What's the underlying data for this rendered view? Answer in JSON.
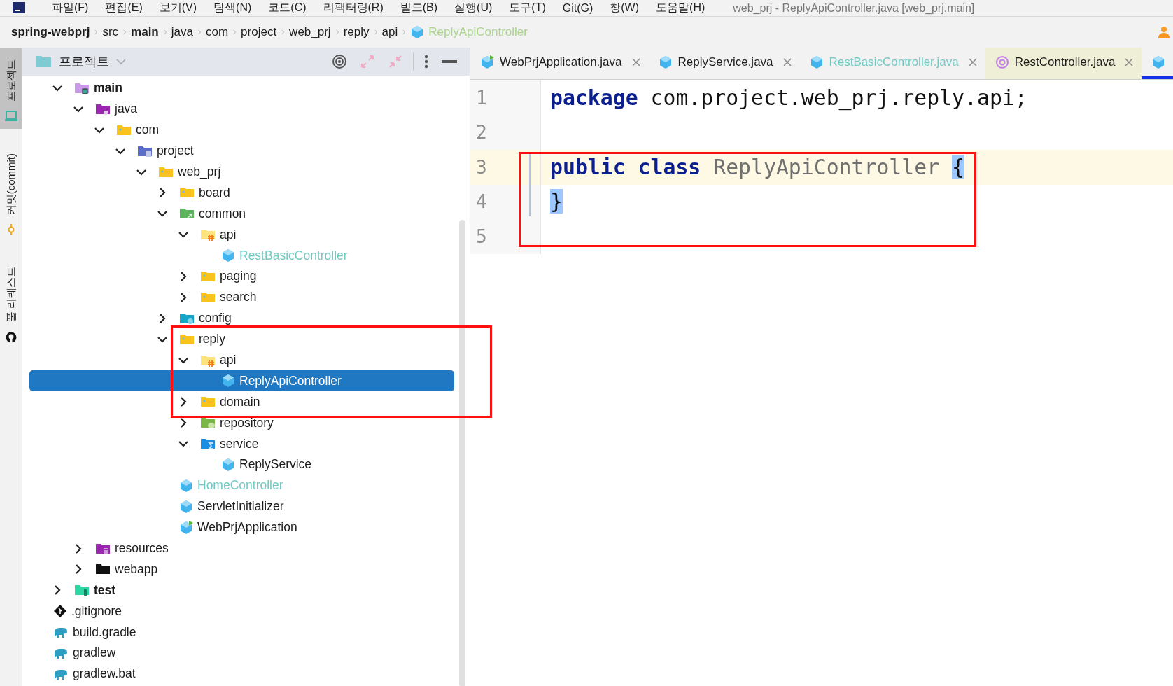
{
  "menu_bar": {
    "items": [
      "파일(F)",
      "편집(E)",
      "보기(V)",
      "탐색(N)",
      "코드(C)",
      "리팩터링(R)",
      "빌드(B)",
      "실행(U)",
      "도구(T)",
      "Git(G)",
      "창(W)",
      "도움말(H)"
    ],
    "title": "web_prj - ReplyApiController.java [web_prj.main]"
  },
  "breadcrumb": [
    {
      "label": "spring-webprj",
      "bold": true,
      "color": "#1b1b1b"
    },
    {
      "label": "src",
      "bold": false,
      "color": "#1b1b1b"
    },
    {
      "label": "main",
      "bold": true,
      "color": "#1b1b1b"
    },
    {
      "label": "java",
      "bold": false,
      "color": "#1b1b1b"
    },
    {
      "label": "com",
      "bold": false,
      "color": "#1b1b1b"
    },
    {
      "label": "project",
      "bold": false,
      "color": "#1b1b1b"
    },
    {
      "label": "web_prj",
      "bold": false,
      "color": "#1b1b1b"
    },
    {
      "label": "reply",
      "bold": false,
      "color": "#1b1b1b"
    },
    {
      "label": "api",
      "bold": false,
      "color": "#1b1b1b"
    },
    {
      "label": "ReplyApiController",
      "bold": false,
      "color": "#a9d48a",
      "kind": "class"
    }
  ],
  "tool_strip": [
    {
      "label": "프로젝트",
      "kind": "monitor",
      "selected": true
    },
    {
      "label": "커밋(commit)",
      "kind": "commit",
      "selected": false
    },
    {
      "label": "풀 리퀘스트",
      "kind": "github",
      "selected": false
    }
  ],
  "project_panel": {
    "title": "프로젝트",
    "toolbar": [
      {
        "kind": "target",
        "disabled": false
      },
      {
        "kind": "expand",
        "disabled": true
      },
      {
        "kind": "collapse",
        "disabled": true
      },
      {
        "kind": "more",
        "disabled": false
      },
      {
        "kind": "minimize",
        "disabled": false
      }
    ],
    "tree": [
      {
        "kind": "scrolled-off-parent",
        "children": [
          {
            "name": "main",
            "kind": "module-main",
            "bold": true,
            "color": "#1b1b1b",
            "selected": false,
            "expanded": true,
            "children": [
              {
                "name": "java",
                "kind": "source-java",
                "bold": false,
                "color": "#1b1b1b",
                "selected": false,
                "expanded": true,
                "children": [
                  {
                    "name": "com",
                    "kind": "package",
                    "bold": false,
                    "color": "#1b1b1b",
                    "selected": false,
                    "expanded": true,
                    "children": [
                      {
                        "name": "project",
                        "kind": "package-blue",
                        "bold": false,
                        "color": "#1b1b1b",
                        "selected": false,
                        "expanded": true,
                        "children": [
                          {
                            "name": "web_prj",
                            "kind": "package",
                            "bold": false,
                            "color": "#1b1b1b",
                            "selected": false,
                            "expanded": true,
                            "children": [
                              {
                                "name": "board",
                                "kind": "package",
                                "bold": false,
                                "color": "#1b1b1b",
                                "selected": false,
                                "expanded": false
                              },
                              {
                                "name": "common",
                                "kind": "common",
                                "bold": false,
                                "color": "#1b1b1b",
                                "selected": false,
                                "expanded": true,
                                "children": [
                                  {
                                    "name": "api",
                                    "kind": "api",
                                    "bold": false,
                                    "color": "#1b1b1b",
                                    "selected": false,
                                    "expanded": true,
                                    "children": [
                                      {
                                        "name": "RestBasicController",
                                        "kind": "class",
                                        "bold": false,
                                        "color": "#73c9c4",
                                        "selected": false
                                      }
                                    ]
                                  },
                                  {
                                    "name": "paging",
                                    "kind": "package",
                                    "bold": false,
                                    "color": "#1b1b1b",
                                    "selected": false,
                                    "expanded": false
                                  },
                                  {
                                    "name": "search",
                                    "kind": "package",
                                    "bold": false,
                                    "color": "#1b1b1b",
                                    "selected": false,
                                    "expanded": false
                                  }
                                ]
                              },
                              {
                                "name": "config",
                                "kind": "config",
                                "bold": false,
                                "color": "#1b1b1b",
                                "selected": false,
                                "expanded": false
                              },
                              {
                                "name": "reply",
                                "kind": "package",
                                "bold": false,
                                "color": "#1b1b1b",
                                "selected": false,
                                "expanded": true,
                                "children": [
                                  {
                                    "name": "api",
                                    "kind": "api",
                                    "bold": false,
                                    "color": "#1b1b1b",
                                    "selected": false,
                                    "expanded": true,
                                    "children": [
                                      {
                                        "name": "ReplyApiController",
                                        "kind": "class",
                                        "bold": false,
                                        "selected": true
                                      }
                                    ]
                                  },
                                  {
                                    "name": "domain",
                                    "kind": "package",
                                    "bold": false,
                                    "color": "#1b1b1b",
                                    "selected": false,
                                    "expanded": false
                                  },
                                  {
                                    "name": "repository",
                                    "kind": "repository",
                                    "bold": false,
                                    "color": "#1b1b1b",
                                    "selected": false,
                                    "expanded": false
                                  },
                                  {
                                    "name": "service",
                                    "kind": "service",
                                    "bold": false,
                                    "color": "#1b1b1b",
                                    "selected": false,
                                    "expanded": true,
                                    "children": [
                                      {
                                        "name": "ReplyService",
                                        "kind": "class",
                                        "bold": false,
                                        "color": "#1b1b1b",
                                        "selected": false
                                      }
                                    ]
                                  }
                                ]
                              },
                              {
                                "name": "HomeController",
                                "kind": "class",
                                "bold": false,
                                "color": "#73c9c4",
                                "selected": false
                              },
                              {
                                "name": "ServletInitializer",
                                "kind": "class",
                                "bold": false,
                                "color": "#1b1b1b",
                                "selected": false
                              },
                              {
                                "name": "WebPrjApplication",
                                "kind": "class-app",
                                "bold": false,
                                "color": "#1b1b1b",
                                "selected": false
                              }
                            ]
                          }
                        ]
                      }
                    ]
                  }
                ]
              },
              {
                "name": "resources",
                "kind": "resources",
                "bold": false,
                "color": "#1b1b1b",
                "selected": false,
                "expanded": false
              },
              {
                "name": "webapp",
                "kind": "webapp",
                "bold": false,
                "color": "#1b1b1b",
                "selected": false,
                "expanded": false
              }
            ]
          },
          {
            "name": "test",
            "kind": "test-root",
            "bold": true,
            "color": "#1b1b1b",
            "selected": false,
            "expanded": false
          }
        ]
      },
      {
        "name": ".gitignore",
        "kind": "gitignore",
        "bold": false,
        "color": "#1b1b1b",
        "selected": false
      },
      {
        "name": "build.gradle",
        "kind": "gradle",
        "bold": false,
        "color": "#1b1b1b",
        "selected": false
      },
      {
        "name": "gradlew",
        "kind": "gradle",
        "bold": false,
        "color": "#1b1b1b",
        "selected": false
      },
      {
        "name": "gradlew.bat",
        "kind": "gradle",
        "bold": false,
        "color": "#1b1b1b",
        "selected": false
      }
    ]
  },
  "editor": {
    "tabs": [
      {
        "label": "WebPrjApplication.java",
        "kind": "class-app",
        "color": "#1b1b1b",
        "highlighted": false,
        "selected": false,
        "closable": true
      },
      {
        "label": "ReplyService.java",
        "kind": "class",
        "color": "#1b1b1b",
        "highlighted": false,
        "selected": false,
        "closable": true
      },
      {
        "label": "RestBasicController.java",
        "kind": "class",
        "color": "#73c9c4",
        "highlighted": false,
        "selected": false,
        "closable": true
      },
      {
        "label": "RestController.java",
        "kind": "annotation",
        "color": "#1b1b1b",
        "highlighted": true,
        "selected": false,
        "closable": true
      },
      {
        "kind": "class",
        "highlighted": false,
        "selected": true,
        "closable": false
      }
    ],
    "lines": [
      {
        "number": "1",
        "current": false,
        "tokens": [
          {
            "text": "package ",
            "kind": "keyword"
          },
          {
            "text": "com.project.web_prj.reply.api;",
            "kind": "plain"
          }
        ]
      },
      {
        "number": "2",
        "current": false
      },
      {
        "number": "3",
        "current": true,
        "tokens": [
          {
            "text": "public ",
            "kind": "keyword"
          },
          {
            "text": "class ",
            "kind": "keyword"
          },
          {
            "text": "ReplyApiController ",
            "kind": "unused"
          },
          {
            "text": "{",
            "kind": "brace-match"
          }
        ]
      },
      {
        "number": "4",
        "current": false,
        "tokens": [
          {
            "text": "}",
            "kind": "brace-match"
          }
        ]
      },
      {
        "number": "5",
        "current": false
      }
    ]
  }
}
